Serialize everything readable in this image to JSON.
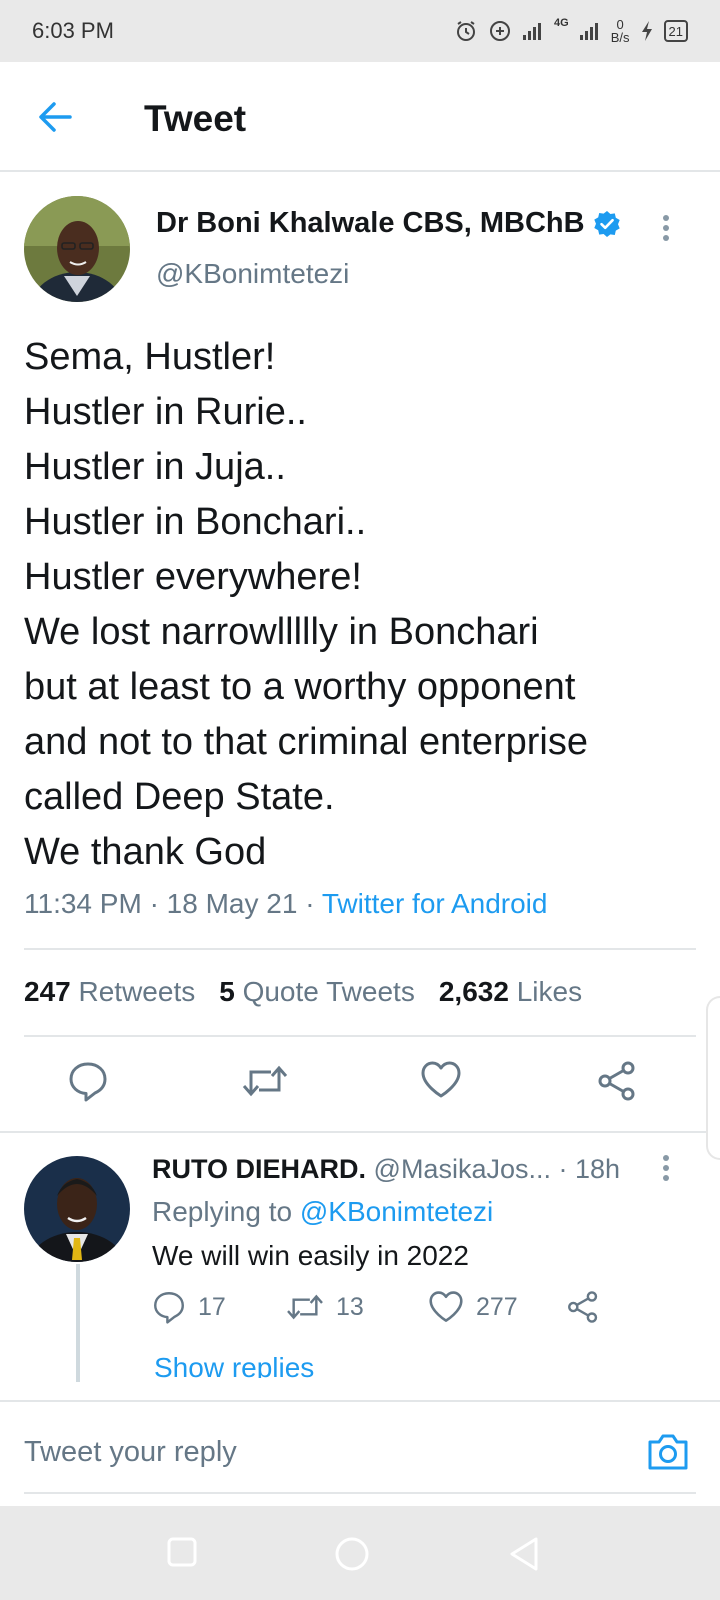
{
  "status_bar": {
    "time": "6:03 PM",
    "network": "4G",
    "speed": "0",
    "speed_unit": "B/s",
    "battery": "21"
  },
  "header": {
    "title": "Tweet"
  },
  "tweet": {
    "author_name": "Dr Boni Khalwale CBS, MBChB",
    "author_handle": "@KBonimtetezi",
    "verified": true,
    "lines": [
      "Sema, Hustler!",
      "Hustler in Rurie..",
      "Hustler in Juja..",
      "Hustler in Bonchari..",
      "Hustler everywhere!",
      "We lost narrowllllly in Bonchari",
      "but at least to a worthy opponent",
      "and not to that criminal enterprise",
      "called Deep State.",
      "We thank God"
    ],
    "time": "11:34 PM",
    "date": "18 May 21",
    "separator": "·",
    "source": "Twitter for Android",
    "stats": {
      "retweets_count": "247",
      "retweets_label": "Retweets",
      "quotes_count": "5",
      "quotes_label": "Quote Tweets",
      "likes_count": "2,632",
      "likes_label": "Likes"
    }
  },
  "reply": {
    "author_name": "RUTO DIEHARD.",
    "author_handle": "@MasikaJos...",
    "age": "· 18h",
    "replying_label": "Replying to",
    "replying_to": "@KBonimtetezi",
    "text": "We will win easily in 2022",
    "comments": "17",
    "retweets": "13",
    "likes": "277",
    "show_replies": "Show replies"
  },
  "composer": {
    "placeholder": "Tweet your reply"
  },
  "colors": {
    "accent": "#1d9bf0",
    "secondary_text": "#657786",
    "divider": "#e3e6e8"
  }
}
